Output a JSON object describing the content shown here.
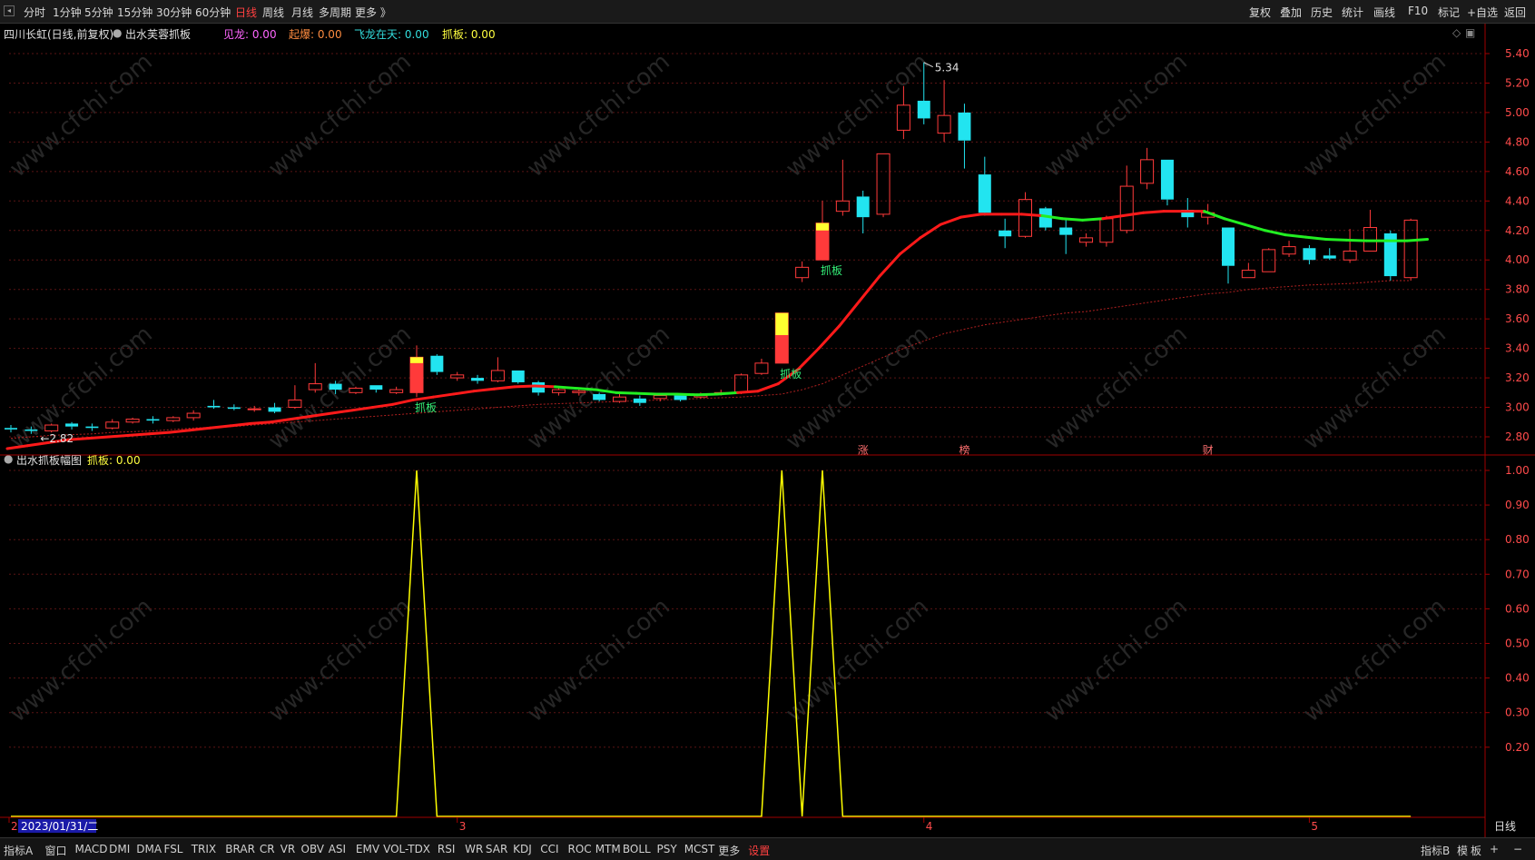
{
  "toolbar": {
    "left": [
      "分时",
      "1分钟",
      "5分钟",
      "15分钟",
      "30分钟",
      "60分钟",
      "日线",
      "周线",
      "月线",
      "多周期",
      "更多 》"
    ],
    "active_index": 6,
    "right": [
      "复权",
      "叠加",
      "历史",
      "统计",
      "画线",
      "F10",
      "标记",
      "+自选",
      "返回"
    ]
  },
  "main_header": {
    "stock": "四川长虹(日线,前复权)",
    "formula": "出水芙蓉抓板",
    "items": [
      {
        "label": "见龙: 0.00",
        "color": "#ff66ff"
      },
      {
        "label": "起爆: 0.00",
        "color": "#ff8c40"
      },
      {
        "label": "飞龙在天: 0.00",
        "color": "#33dddd"
      },
      {
        "label": "抓板: 0.00",
        "color": "#ffff40"
      }
    ]
  },
  "indicator_header": {
    "name": "出水抓板幅图",
    "item": {
      "label": "抓板: 0.00",
      "color": "#ffff40"
    }
  },
  "colors": {
    "up": "#ff3a3a",
    "down": "#22e4f0",
    "ma_up": "#ff1a1a",
    "ma_flat": "#22ee22",
    "grid": "#5a1414",
    "axis": "#a00000",
    "signal": "#ffff00",
    "text": "#c8c8c8"
  },
  "chart_data": {
    "type": "candlestick",
    "price_axis_ticks": [
      "5.40",
      "5.20",
      "5.00",
      "4.80",
      "4.60",
      "4.40",
      "4.20",
      "4.00",
      "3.80",
      "3.60",
      "3.40",
      "3.20",
      "3.00",
      "2.80"
    ],
    "ylim": [
      2.72,
      5.48
    ],
    "candles": [
      {
        "o": 2.86,
        "h": 2.88,
        "l": 2.83,
        "c": 2.85
      },
      {
        "o": 2.85,
        "h": 2.87,
        "l": 2.82,
        "c": 2.84
      },
      {
        "o": 2.84,
        "h": 2.89,
        "l": 2.83,
        "c": 2.88
      },
      {
        "o": 2.89,
        "h": 2.9,
        "l": 2.85,
        "c": 2.87
      },
      {
        "o": 2.87,
        "h": 2.89,
        "l": 2.84,
        "c": 2.86
      },
      {
        "o": 2.86,
        "h": 2.92,
        "l": 2.85,
        "c": 2.9
      },
      {
        "o": 2.9,
        "h": 2.93,
        "l": 2.89,
        "c": 2.92
      },
      {
        "o": 2.92,
        "h": 2.94,
        "l": 2.89,
        "c": 2.91
      },
      {
        "o": 2.91,
        "h": 2.94,
        "l": 2.9,
        "c": 2.93
      },
      {
        "o": 2.93,
        "h": 2.98,
        "l": 2.91,
        "c": 2.96
      },
      {
        "o": 3.01,
        "h": 3.05,
        "l": 2.99,
        "c": 3.0
      },
      {
        "o": 3.0,
        "h": 3.02,
        "l": 2.98,
        "c": 2.99
      },
      {
        "o": 2.99,
        "h": 3.01,
        "l": 2.97,
        "c": 2.99
      },
      {
        "o": 3.0,
        "h": 3.03,
        "l": 2.96,
        "c": 2.97
      },
      {
        "o": 3.0,
        "h": 3.15,
        "l": 2.99,
        "c": 3.05
      },
      {
        "o": 3.12,
        "h": 3.3,
        "l": 3.1,
        "c": 3.16
      },
      {
        "o": 3.16,
        "h": 3.18,
        "l": 3.09,
        "c": 3.12
      },
      {
        "o": 3.1,
        "h": 3.14,
        "l": 3.09,
        "c": 3.13
      },
      {
        "o": 3.15,
        "h": 3.15,
        "l": 3.1,
        "c": 3.12
      },
      {
        "o": 3.1,
        "h": 3.14,
        "l": 3.09,
        "c": 3.12
      },
      {
        "o": 3.1,
        "h": 3.42,
        "l": 3.07,
        "c": 3.34
      },
      {
        "o": 3.35,
        "h": 3.36,
        "l": 3.22,
        "c": 3.24
      },
      {
        "o": 3.2,
        "h": 3.24,
        "l": 3.18,
        "c": 3.22
      },
      {
        "o": 3.2,
        "h": 3.22,
        "l": 3.16,
        "c": 3.18
      },
      {
        "o": 3.18,
        "h": 3.34,
        "l": 3.17,
        "c": 3.25
      },
      {
        "o": 3.25,
        "h": 3.25,
        "l": 3.16,
        "c": 3.17
      },
      {
        "o": 3.17,
        "h": 3.18,
        "l": 3.08,
        "c": 3.1
      },
      {
        "o": 3.1,
        "h": 3.13,
        "l": 3.08,
        "c": 3.12
      },
      {
        "o": 3.1,
        "h": 3.13,
        "l": 3.08,
        "c": 3.11
      },
      {
        "o": 3.09,
        "h": 3.1,
        "l": 3.04,
        "c": 3.05
      },
      {
        "o": 3.04,
        "h": 3.09,
        "l": 3.03,
        "c": 3.07
      },
      {
        "o": 3.06,
        "h": 3.08,
        "l": 3.01,
        "c": 3.03
      },
      {
        "o": 3.06,
        "h": 3.09,
        "l": 3.04,
        "c": 3.08
      },
      {
        "o": 3.08,
        "h": 3.09,
        "l": 3.04,
        "c": 3.05
      },
      {
        "o": 3.07,
        "h": 3.1,
        "l": 3.06,
        "c": 3.08
      },
      {
        "o": 3.09,
        "h": 3.12,
        "l": 3.08,
        "c": 3.1
      },
      {
        "o": 3.1,
        "h": 3.23,
        "l": 3.09,
        "c": 3.22
      },
      {
        "o": 3.23,
        "h": 3.33,
        "l": 3.22,
        "c": 3.3
      },
      {
        "o": 3.3,
        "h": 3.64,
        "l": 3.3,
        "c": 3.64
      },
      {
        "o": 3.88,
        "h": 3.99,
        "l": 3.85,
        "c": 3.95
      },
      {
        "o": 4.0,
        "h": 4.4,
        "l": 4.0,
        "c": 4.25
      },
      {
        "o": 4.33,
        "h": 4.68,
        "l": 4.3,
        "c": 4.4
      },
      {
        "o": 4.43,
        "h": 4.47,
        "l": 4.18,
        "c": 4.29
      },
      {
        "o": 4.31,
        "h": 4.72,
        "l": 4.29,
        "c": 4.72
      },
      {
        "o": 4.88,
        "h": 5.18,
        "l": 4.82,
        "c": 5.05
      },
      {
        "o": 5.08,
        "h": 5.34,
        "l": 4.92,
        "c": 4.96
      },
      {
        "o": 4.86,
        "h": 5.22,
        "l": 4.8,
        "c": 4.98
      },
      {
        "o": 5.0,
        "h": 5.06,
        "l": 4.62,
        "c": 4.81
      },
      {
        "o": 4.58,
        "h": 4.7,
        "l": 4.3,
        "c": 4.32
      },
      {
        "o": 4.2,
        "h": 4.28,
        "l": 4.08,
        "c": 4.16
      },
      {
        "o": 4.16,
        "h": 4.46,
        "l": 4.15,
        "c": 4.41
      },
      {
        "o": 4.35,
        "h": 4.36,
        "l": 4.2,
        "c": 4.22
      },
      {
        "o": 4.22,
        "h": 4.27,
        "l": 4.04,
        "c": 4.17
      },
      {
        "o": 4.12,
        "h": 4.18,
        "l": 4.09,
        "c": 4.15
      },
      {
        "o": 4.12,
        "h": 4.3,
        "l": 4.09,
        "c": 4.28
      },
      {
        "o": 4.2,
        "h": 4.64,
        "l": 4.18,
        "c": 4.5
      },
      {
        "o": 4.52,
        "h": 4.76,
        "l": 4.48,
        "c": 4.68
      },
      {
        "o": 4.68,
        "h": 4.68,
        "l": 4.37,
        "c": 4.41
      },
      {
        "o": 4.34,
        "h": 4.42,
        "l": 4.22,
        "c": 4.29
      },
      {
        "o": 4.29,
        "h": 4.38,
        "l": 4.24,
        "c": 4.32
      },
      {
        "o": 4.22,
        "h": 4.22,
        "l": 3.84,
        "c": 3.96
      },
      {
        "o": 3.88,
        "h": 3.98,
        "l": 3.88,
        "c": 3.93
      },
      {
        "o": 3.92,
        "h": 4.08,
        "l": 3.92,
        "c": 4.07
      },
      {
        "o": 4.04,
        "h": 4.13,
        "l": 4.02,
        "c": 4.09
      },
      {
        "o": 4.08,
        "h": 4.1,
        "l": 3.97,
        "c": 4.0
      },
      {
        "o": 4.03,
        "h": 4.08,
        "l": 4.0,
        "c": 4.01
      },
      {
        "o": 4.0,
        "h": 4.21,
        "l": 3.98,
        "c": 4.06
      },
      {
        "o": 4.06,
        "h": 4.34,
        "l": 4.06,
        "c": 4.22
      },
      {
        "o": 4.18,
        "h": 4.2,
        "l": 3.86,
        "c": 3.89
      },
      {
        "o": 3.88,
        "h": 4.28,
        "l": 3.86,
        "c": 4.27
      }
    ],
    "ma_line": [
      2.72,
      2.74,
      2.76,
      2.78,
      2.79,
      2.8,
      2.81,
      2.82,
      2.83,
      2.845,
      2.86,
      2.875,
      2.89,
      2.9,
      2.92,
      2.94,
      2.96,
      2.98,
      3.0,
      3.02,
      3.05,
      3.07,
      3.09,
      3.11,
      3.125,
      3.14,
      3.145,
      3.14,
      3.13,
      3.12,
      3.1,
      3.095,
      3.09,
      3.09,
      3.085,
      3.09,
      3.1,
      3.11,
      3.16,
      3.26,
      3.4,
      3.55,
      3.72,
      3.89,
      4.04,
      4.15,
      4.24,
      4.29,
      4.31,
      4.31,
      4.31,
      4.3,
      4.28,
      4.27,
      4.28,
      4.3,
      4.32,
      4.33,
      4.33,
      4.33,
      4.28,
      4.24,
      4.2,
      4.17,
      4.155,
      4.14,
      4.135,
      4.13,
      4.13,
      4.13,
      4.14
    ],
    "ma_green_ranges": [
      [
        27,
        36
      ],
      [
        51,
        54
      ],
      [
        59,
        71
      ]
    ],
    "ma_dashed": [
      2.79,
      2.8,
      2.81,
      2.815,
      2.82,
      2.83,
      2.835,
      2.84,
      2.85,
      2.86,
      2.865,
      2.87,
      2.88,
      2.89,
      2.9,
      2.91,
      2.92,
      2.93,
      2.94,
      2.95,
      2.96,
      2.97,
      2.98,
      2.99,
      3.0,
      3.01,
      3.02,
      3.025,
      3.03,
      3.035,
      3.04,
      3.045,
      3.05,
      3.055,
      3.06,
      3.065,
      3.07,
      3.08,
      3.09,
      3.12,
      3.16,
      3.22,
      3.28,
      3.34,
      3.4,
      3.45,
      3.5,
      3.53,
      3.56,
      3.58,
      3.6,
      3.62,
      3.64,
      3.65,
      3.67,
      3.69,
      3.71,
      3.73,
      3.75,
      3.77,
      3.78,
      3.8,
      3.81,
      3.82,
      3.83,
      3.835,
      3.84,
      3.85,
      3.86,
      3.86
    ],
    "zhuaban_markers": [
      {
        "i": 20,
        "label": "抓板",
        "yellow": [
          3.34,
          3.3
        ]
      },
      {
        "i": 38,
        "label": "抓板",
        "yellow": [
          3.64,
          3.49
        ]
      },
      {
        "i": 40,
        "label": "抓板",
        "yellow": [
          4.25,
          4.2
        ]
      }
    ],
    "max_label": {
      "i": 45,
      "text": "5.34"
    },
    "min_label": {
      "i": 1,
      "text": "2.82"
    },
    "event_markers": [
      {
        "i": 42,
        "text": "涨"
      },
      {
        "i": 47,
        "text": "榜"
      },
      {
        "i": 59,
        "text": "财"
      }
    ],
    "indicator_axis_ticks": [
      "1.00",
      "0.90",
      "0.80",
      "0.70",
      "0.60",
      "0.50",
      "0.40",
      "0.30",
      "0.20"
    ],
    "indicator_ylim": [
      0.0,
      1.0
    ],
    "indicator_values_nonzero": [
      {
        "i": 20,
        "v": 1.0
      },
      {
        "i": 38,
        "v": 1.0
      },
      {
        "i": 40,
        "v": 1.0
      }
    ],
    "x_labels": [
      {
        "i": 0,
        "text": "2"
      },
      {
        "i": 22,
        "text": "3"
      },
      {
        "i": 45,
        "text": "4"
      },
      {
        "i": 64,
        "text": "5"
      }
    ],
    "date_label": "2023/01/31/二",
    "period_label": "日线"
  },
  "watermark": "www.cfchi.com",
  "bottom": {
    "tabs": [
      "指标A",
      "窗口",
      "MACD",
      "DMI",
      "DMA",
      "FSL",
      "TRIX",
      "BRAR",
      "CR",
      "VR",
      "OBV",
      "ASI",
      "EMV",
      "VOL-TDX",
      "RSI",
      "WR",
      "SAR",
      "KDJ",
      "CCI",
      "ROC",
      "MTM",
      "BOLL",
      "PSY",
      "MCST",
      "更多",
      "设置"
    ],
    "right": [
      "指标B",
      "模",
      "板",
      "+",
      "−"
    ]
  }
}
